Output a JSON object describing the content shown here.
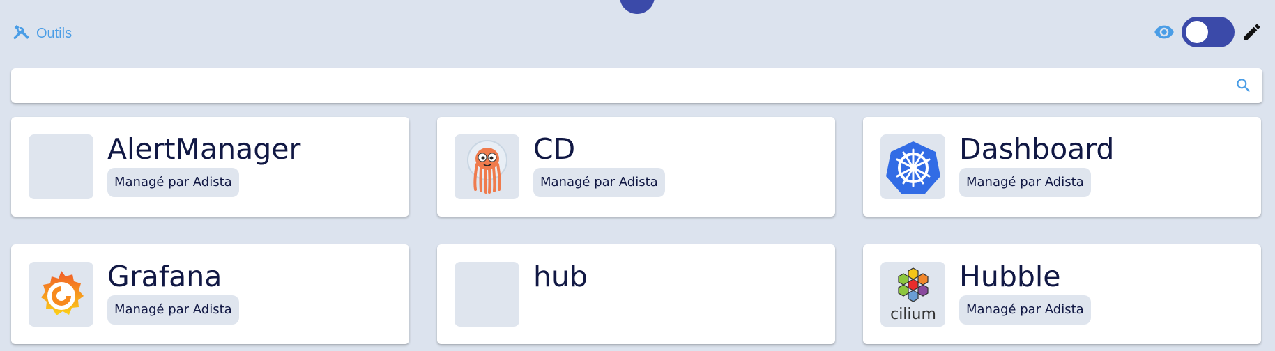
{
  "header": {
    "tools_label": "Outils",
    "tools_icon": "tools-icon",
    "view_icon": "eye-icon",
    "edit_icon": "pencil-icon",
    "toggle_state": "off"
  },
  "search": {
    "value": "",
    "placeholder": "",
    "icon": "search-icon"
  },
  "colors": {
    "background": "#dce3ee",
    "accent": "#3b4aa9",
    "link": "#4a9de6",
    "card_bg": "#ffffff",
    "tile_bg": "#dfe5ee",
    "title_text": "#111844"
  },
  "apps": [
    {
      "name": "AlertManager",
      "badge": "Managé par Adista",
      "icon": "empty-icon"
    },
    {
      "name": "CD",
      "badge": "Managé par Adista",
      "icon": "argo-icon"
    },
    {
      "name": "Dashboard",
      "badge": "Managé par Adista",
      "icon": "kubernetes-icon"
    },
    {
      "name": "Grafana",
      "badge": "Managé par Adista",
      "icon": "grafana-icon"
    },
    {
      "name": "hub",
      "badge": "",
      "icon": "empty-icon"
    },
    {
      "name": "Hubble",
      "badge": "Managé par Adista",
      "icon": "cilium-icon",
      "icon_text": "cilium"
    }
  ]
}
